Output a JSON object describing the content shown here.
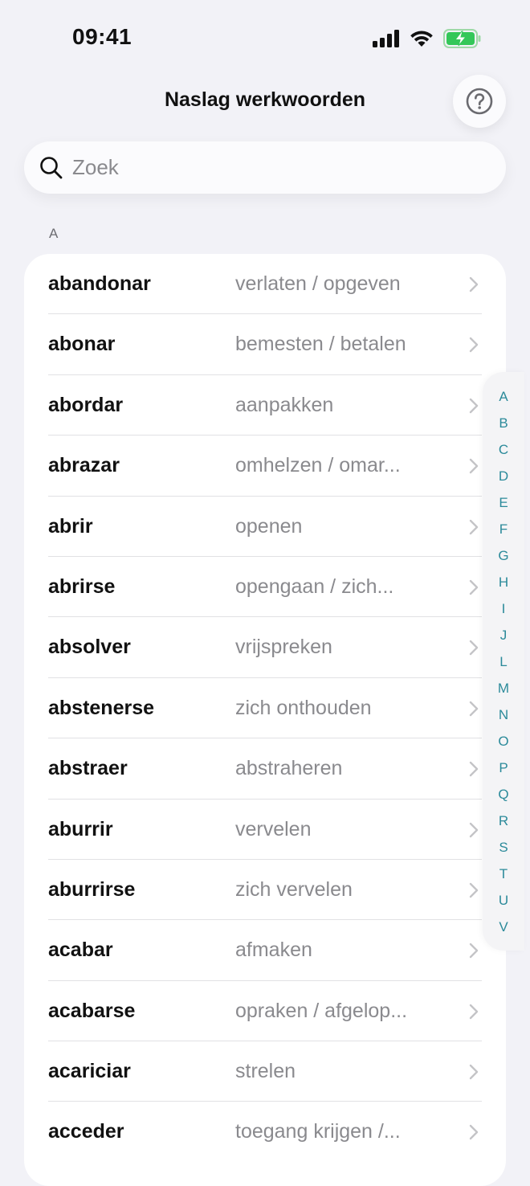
{
  "status_bar": {
    "time": "09:41",
    "icons": [
      "cellular-signal-icon",
      "wifi-icon",
      "battery-charging-icon"
    ]
  },
  "nav": {
    "title": "Naslag werkwoorden",
    "help_icon": "question-mark-circle-icon"
  },
  "search": {
    "placeholder": "Zoek",
    "value": "",
    "icon": "search-icon"
  },
  "section": {
    "header": "A"
  },
  "verbs": [
    {
      "verb": "abandonar",
      "translation": "verlaten / opgeven"
    },
    {
      "verb": "abonar",
      "translation": "bemesten / betalen"
    },
    {
      "verb": "abordar",
      "translation": "aanpakken"
    },
    {
      "verb": "abrazar",
      "translation": "omhelzen / omar..."
    },
    {
      "verb": "abrir",
      "translation": "openen"
    },
    {
      "verb": "abrirse",
      "translation": "opengaan / zich..."
    },
    {
      "verb": "absolver",
      "translation": "vrijspreken"
    },
    {
      "verb": "abstenerse",
      "translation": "zich onthouden"
    },
    {
      "verb": "abstraer",
      "translation": "abstraheren"
    },
    {
      "verb": "aburrir",
      "translation": "vervelen"
    },
    {
      "verb": "aburrirse",
      "translation": "zich vervelen"
    },
    {
      "verb": "acabar",
      "translation": "afmaken"
    },
    {
      "verb": "acabarse",
      "translation": "opraken / afgelop..."
    },
    {
      "verb": "acariciar",
      "translation": "strelen"
    },
    {
      "verb": "acceder",
      "translation": "toegang krijgen /..."
    }
  ],
  "alphabet_index": [
    "A",
    "B",
    "C",
    "D",
    "E",
    "F",
    "G",
    "H",
    "I",
    "J",
    "L",
    "M",
    "N",
    "O",
    "P",
    "Q",
    "R",
    "S",
    "T",
    "U",
    "V"
  ],
  "colors": {
    "background": "#f2f2f7",
    "accent": "#2b8a9a",
    "secondary_text": "#8a8a8e",
    "battery_fill": "#34c759"
  }
}
